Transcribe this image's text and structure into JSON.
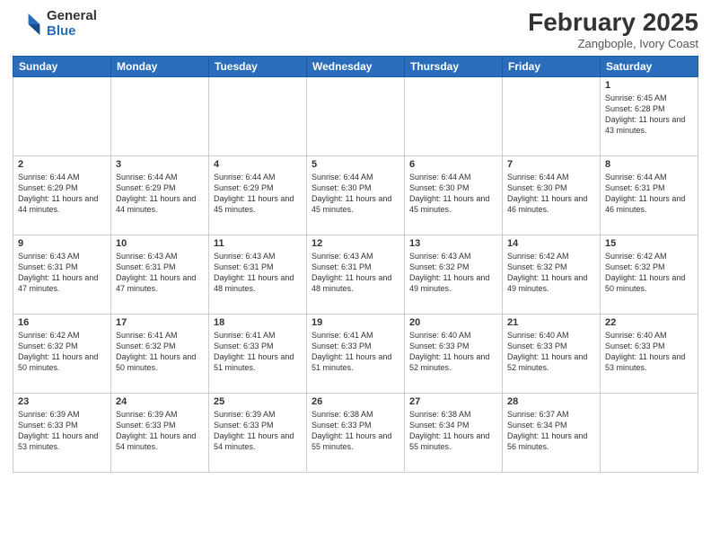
{
  "header": {
    "logo_general": "General",
    "logo_blue": "Blue",
    "month_title": "February 2025",
    "location": "Zangbople, Ivory Coast"
  },
  "weekdays": [
    "Sunday",
    "Monday",
    "Tuesday",
    "Wednesday",
    "Thursday",
    "Friday",
    "Saturday"
  ],
  "weeks": [
    [
      {
        "day": "",
        "info": ""
      },
      {
        "day": "",
        "info": ""
      },
      {
        "day": "",
        "info": ""
      },
      {
        "day": "",
        "info": ""
      },
      {
        "day": "",
        "info": ""
      },
      {
        "day": "",
        "info": ""
      },
      {
        "day": "1",
        "info": "Sunrise: 6:45 AM\nSunset: 6:28 PM\nDaylight: 11 hours and 43 minutes."
      }
    ],
    [
      {
        "day": "2",
        "info": "Sunrise: 6:44 AM\nSunset: 6:29 PM\nDaylight: 11 hours and 44 minutes."
      },
      {
        "day": "3",
        "info": "Sunrise: 6:44 AM\nSunset: 6:29 PM\nDaylight: 11 hours and 44 minutes."
      },
      {
        "day": "4",
        "info": "Sunrise: 6:44 AM\nSunset: 6:29 PM\nDaylight: 11 hours and 45 minutes."
      },
      {
        "day": "5",
        "info": "Sunrise: 6:44 AM\nSunset: 6:30 PM\nDaylight: 11 hours and 45 minutes."
      },
      {
        "day": "6",
        "info": "Sunrise: 6:44 AM\nSunset: 6:30 PM\nDaylight: 11 hours and 45 minutes."
      },
      {
        "day": "7",
        "info": "Sunrise: 6:44 AM\nSunset: 6:30 PM\nDaylight: 11 hours and 46 minutes."
      },
      {
        "day": "8",
        "info": "Sunrise: 6:44 AM\nSunset: 6:31 PM\nDaylight: 11 hours and 46 minutes."
      }
    ],
    [
      {
        "day": "9",
        "info": "Sunrise: 6:43 AM\nSunset: 6:31 PM\nDaylight: 11 hours and 47 minutes."
      },
      {
        "day": "10",
        "info": "Sunrise: 6:43 AM\nSunset: 6:31 PM\nDaylight: 11 hours and 47 minutes."
      },
      {
        "day": "11",
        "info": "Sunrise: 6:43 AM\nSunset: 6:31 PM\nDaylight: 11 hours and 48 minutes."
      },
      {
        "day": "12",
        "info": "Sunrise: 6:43 AM\nSunset: 6:31 PM\nDaylight: 11 hours and 48 minutes."
      },
      {
        "day": "13",
        "info": "Sunrise: 6:43 AM\nSunset: 6:32 PM\nDaylight: 11 hours and 49 minutes."
      },
      {
        "day": "14",
        "info": "Sunrise: 6:42 AM\nSunset: 6:32 PM\nDaylight: 11 hours and 49 minutes."
      },
      {
        "day": "15",
        "info": "Sunrise: 6:42 AM\nSunset: 6:32 PM\nDaylight: 11 hours and 50 minutes."
      }
    ],
    [
      {
        "day": "16",
        "info": "Sunrise: 6:42 AM\nSunset: 6:32 PM\nDaylight: 11 hours and 50 minutes."
      },
      {
        "day": "17",
        "info": "Sunrise: 6:41 AM\nSunset: 6:32 PM\nDaylight: 11 hours and 50 minutes."
      },
      {
        "day": "18",
        "info": "Sunrise: 6:41 AM\nSunset: 6:33 PM\nDaylight: 11 hours and 51 minutes."
      },
      {
        "day": "19",
        "info": "Sunrise: 6:41 AM\nSunset: 6:33 PM\nDaylight: 11 hours and 51 minutes."
      },
      {
        "day": "20",
        "info": "Sunrise: 6:40 AM\nSunset: 6:33 PM\nDaylight: 11 hours and 52 minutes."
      },
      {
        "day": "21",
        "info": "Sunrise: 6:40 AM\nSunset: 6:33 PM\nDaylight: 11 hours and 52 minutes."
      },
      {
        "day": "22",
        "info": "Sunrise: 6:40 AM\nSunset: 6:33 PM\nDaylight: 11 hours and 53 minutes."
      }
    ],
    [
      {
        "day": "23",
        "info": "Sunrise: 6:39 AM\nSunset: 6:33 PM\nDaylight: 11 hours and 53 minutes."
      },
      {
        "day": "24",
        "info": "Sunrise: 6:39 AM\nSunset: 6:33 PM\nDaylight: 11 hours and 54 minutes."
      },
      {
        "day": "25",
        "info": "Sunrise: 6:39 AM\nSunset: 6:33 PM\nDaylight: 11 hours and 54 minutes."
      },
      {
        "day": "26",
        "info": "Sunrise: 6:38 AM\nSunset: 6:33 PM\nDaylight: 11 hours and 55 minutes."
      },
      {
        "day": "27",
        "info": "Sunrise: 6:38 AM\nSunset: 6:34 PM\nDaylight: 11 hours and 55 minutes."
      },
      {
        "day": "28",
        "info": "Sunrise: 6:37 AM\nSunset: 6:34 PM\nDaylight: 11 hours and 56 minutes."
      },
      {
        "day": "",
        "info": ""
      }
    ]
  ]
}
